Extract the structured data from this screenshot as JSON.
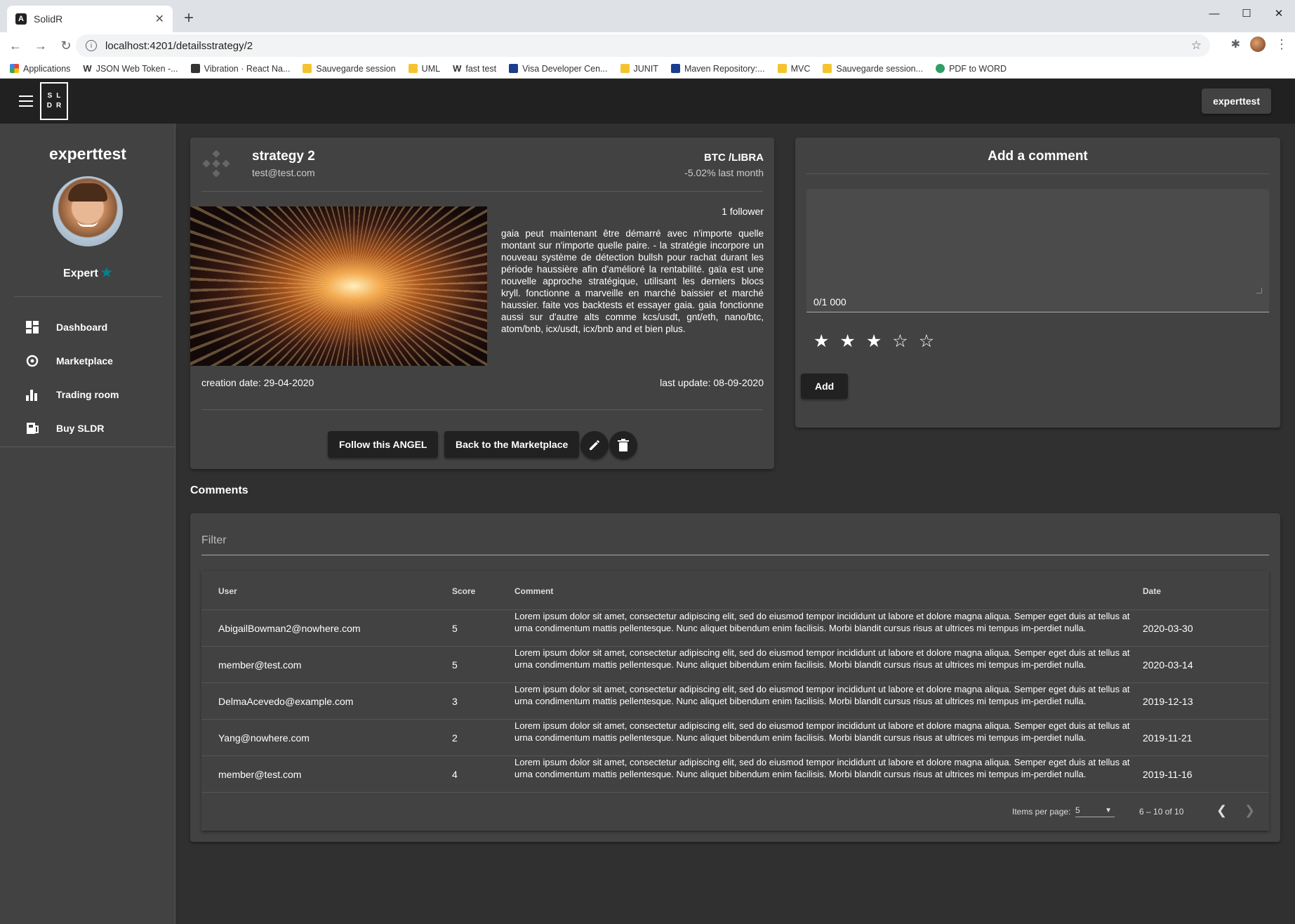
{
  "browser": {
    "tab_title": "SolidR",
    "tab_favicon": "A",
    "url": "localhost:4201/detailsstrategy/2",
    "bookmarks": [
      {
        "label": "Applications",
        "icon": "apps-grid-icon"
      },
      {
        "label": "JSON Web Token -...",
        "icon": "w-icon"
      },
      {
        "label": "Vibration · React Na...",
        "icon": "react-icon"
      },
      {
        "label": "Sauvegarde session",
        "icon": "folder-icon"
      },
      {
        "label": "UML",
        "icon": "folder-icon"
      },
      {
        "label": "fast test",
        "icon": "w-icon"
      },
      {
        "label": "Visa Developer Cen...",
        "icon": "visa-icon"
      },
      {
        "label": "JUNIT",
        "icon": "folder-icon"
      },
      {
        "label": "Maven Repository:...",
        "icon": "maven-icon"
      },
      {
        "label": "MVC",
        "icon": "folder-icon"
      },
      {
        "label": "Sauvegarde session...",
        "icon": "folder-icon"
      },
      {
        "label": "PDF to WORD",
        "icon": "pdf-icon"
      }
    ]
  },
  "appbar": {
    "logo_lines": [
      "SL",
      "DR"
    ],
    "user_button": "experttest"
  },
  "sidebar": {
    "username": "experttest",
    "role": "Expert",
    "items": [
      {
        "label": "Dashboard",
        "icon": "dashboard-icon"
      },
      {
        "label": "Marketplace",
        "icon": "marketplace-icon"
      },
      {
        "label": "Trading room",
        "icon": "bar-chart-icon"
      },
      {
        "label": "Buy SLDR",
        "icon": "buy-icon"
      }
    ]
  },
  "strategy": {
    "title": "strategy 2",
    "email": "test@test.com",
    "pair": "BTC /LIBRA",
    "performance": "-5.02% last month",
    "followers": "1 follower",
    "description": "gaia peut maintenant être démarré avec n'importe quelle montant sur n'importe quelle paire. - la stratégie incorpore un nouveau système de détection bullsh pour rachat durant les période haussière afin d'amélioré la rentabilité. gaïa est une nouvelle approche stratégique, utilisant les derniers blocs kryll. fonctionne a marveille en marché baissier et marché haussier. faite vos backtests et essayer gaia. gaia fonctionne aussi sur d'autre alts comme kcs/usdt, gnt/eth, nano/btc, atom/bnb, icx/usdt, icx/bnb and et bien plus.",
    "creation_date": "creation date: 29-04-2020",
    "last_update": "last update: 08-09-2020",
    "follow_button": "Follow this ANGEL",
    "back_button": "Back to the Marketplace"
  },
  "add_comment": {
    "title": "Add a comment",
    "counter": "0/1 000",
    "rating": 3,
    "max_rating": 5,
    "add_button": "Add"
  },
  "comments": {
    "section_title": "Comments",
    "filter_placeholder": "Filter",
    "columns": [
      "User",
      "Score",
      "Comment",
      "Date"
    ],
    "rows": [
      {
        "user": "AbigailBowman2@nowhere.com",
        "score": "5",
        "comment": "Lorem ipsum dolor sit amet, consectetur adipiscing elit, sed do eiusmod tempor incididunt ut labore et dolore magna aliqua. Semper eget duis at tellus at urna condimentum mattis pellentesque. Nunc aliquet bibendum enim facilisis. Morbi blandit cursus risus at ultrices mi tempus im-perdiet nulla.",
        "date": "2020-03-30"
      },
      {
        "user": "member@test.com",
        "score": "5",
        "comment": "Lorem ipsum dolor sit amet, consectetur adipiscing elit, sed do eiusmod tempor incididunt ut labore et dolore magna aliqua. Semper eget duis at tellus at urna condimentum mattis pellentesque. Nunc aliquet bibendum enim facilisis. Morbi blandit cursus risus at ultrices mi tempus im-perdiet nulla.",
        "date": "2020-03-14"
      },
      {
        "user": "DelmaAcevedo@example.com",
        "score": "3",
        "comment": "Lorem ipsum dolor sit amet, consectetur adipiscing elit, sed do eiusmod tempor incididunt ut labore et dolore magna aliqua. Semper eget duis at tellus at urna condimentum mattis pellentesque. Nunc aliquet bibendum enim facilisis. Morbi blandit cursus risus at ultrices mi tempus im-perdiet nulla.",
        "date": "2019-12-13"
      },
      {
        "user": "Yang@nowhere.com",
        "score": "2",
        "comment": "Lorem ipsum dolor sit amet, consectetur adipiscing elit, sed do eiusmod tempor incididunt ut labore et dolore magna aliqua. Semper eget duis at tellus at urna condimentum mattis pellentesque. Nunc aliquet bibendum enim facilisis. Morbi blandit cursus risus at ultrices mi tempus im-perdiet nulla.",
        "date": "2019-11-21"
      },
      {
        "user": "member@test.com",
        "score": "4",
        "comment": "Lorem ipsum dolor sit amet, consectetur adipiscing elit, sed do eiusmod tempor incididunt ut labore et dolore magna aliqua. Semper eget duis at tellus at urna condimentum mattis pellentesque. Nunc aliquet bibendum enim facilisis. Morbi blandit cursus risus at ultrices mi tempus im-perdiet nulla.",
        "date": "2019-11-16"
      }
    ],
    "paginator": {
      "items_per_page_label": "Items per page:",
      "items_per_page": "5",
      "range": "6 – 10 of 10"
    }
  },
  "colors": {
    "background": "#303030",
    "card": "#424242",
    "appbar": "#212121",
    "accent_star": "#00838f"
  }
}
